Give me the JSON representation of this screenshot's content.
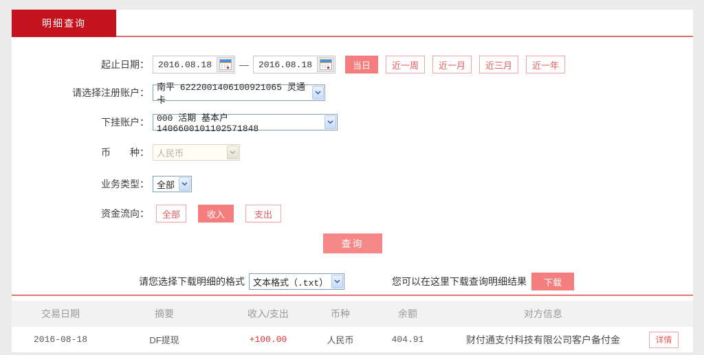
{
  "tab": {
    "label": "明细查询"
  },
  "form": {
    "date_label": "起止日期：",
    "date_from": "2016.08.18",
    "date_sep": "—",
    "date_to": "2016.08.18",
    "quick_buttons": {
      "today": "当日",
      "week": "近一周",
      "month": "近一月",
      "quarter": "近三月",
      "year": "近一年"
    },
    "reg_account_label": "请选择注册账户：",
    "reg_account_value": "南平 6222001406100921065 灵通卡",
    "sub_account_label": "下挂账户：",
    "sub_account_value": "000 活期 基本户 1406600101102571848",
    "currency_label": "币　　种：",
    "currency_value": "人民币",
    "biz_type_label": "业务类型：",
    "biz_type_value": "全部",
    "flow_label": "资金流向：",
    "flow_all": "全部",
    "flow_in": "收入",
    "flow_out": "支出",
    "query_button": "查询"
  },
  "download": {
    "format_label": "请您选择下载明细的格式",
    "format_value": "文本格式（.txt）",
    "hint": "您可以在这里下载查询明细结果",
    "button": "下载"
  },
  "table": {
    "headers": [
      "交易日期",
      "摘要",
      "收入/支出",
      "币种",
      "余额",
      "对方信息"
    ],
    "rows": [
      {
        "date": "2016-08-18",
        "summary": "DF提现",
        "amount": "+100.00",
        "currency": "人民币",
        "balance": "404.91",
        "counterparty": "财付通支付科技有限公司客户备付金",
        "detail": "详情"
      }
    ]
  },
  "icons": {
    "calendar": "calendar-icon",
    "dropdown": "chevron-down-icon"
  },
  "colors": {
    "tab_red": "#c5131d",
    "pink_button": "#f47e7e",
    "divider_red": "#e86f6f",
    "amount_red": "#d9302e",
    "select_border": "#7f9db9",
    "page_bg": "#ebebeb"
  }
}
